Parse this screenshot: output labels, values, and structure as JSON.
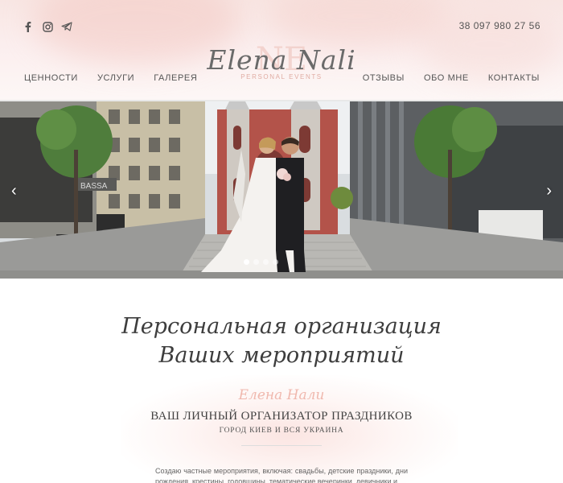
{
  "header": {
    "social": [
      {
        "name": "facebook-icon",
        "glyph": "f"
      },
      {
        "name": "instagram-icon",
        "glyph": "◘"
      },
      {
        "name": "telegram-icon",
        "glyph": "➤"
      }
    ],
    "phone": "38 097 980 27 56",
    "logo": {
      "monogram": "NE",
      "name": "Elena Nali",
      "subtitle": "PERSONAL EVENTS"
    },
    "nav_left": [
      "ЦЕННОСТИ",
      "УСЛУГИ",
      "ГАЛЕРЕЯ"
    ],
    "nav_right": [
      "ОТЗЫВЫ",
      "ОБО МНЕ",
      "КОНТАКТЫ"
    ]
  },
  "slider": {
    "prev_glyph": "‹",
    "next_glyph": "›",
    "dots": 4,
    "active_dot": 0,
    "sign_text": "BASSA"
  },
  "content": {
    "headline_line1": "Персональная организация",
    "headline_line2": "Ваших мероприятий",
    "signature": "Елена Нали",
    "heading": "ВАШ ЛИЧНЫЙ ОРГАНИЗАТОР ПРАЗДНИКОВ",
    "subheading": "ГОРОД КИЕВ И ВСЯ УКРАИНА",
    "body": "Создаю частные мероприятия, включая: свадьбы, детские праздники, дни рождения, крестины, годовщины, тематические вечеринки, девичники и"
  },
  "colors": {
    "accent": "#f0b8ae",
    "text": "#555555",
    "header_bg": "#f8e6e3"
  }
}
